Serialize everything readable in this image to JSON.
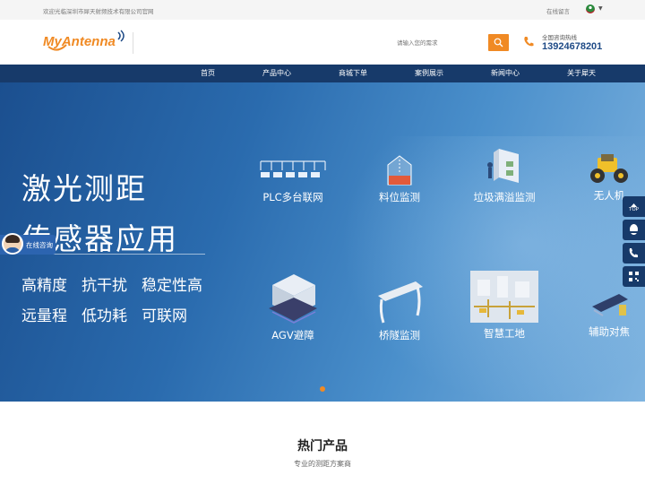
{
  "topbar": {
    "welcome": "欢迎光临深圳市犀天射频技术有限公司官网",
    "message": "在线留言",
    "lang_icon": "flag-icon"
  },
  "header": {
    "logo": "MyAntenna",
    "search_placeholder": "请输入您的需求",
    "hotline_label": "全国咨询热线",
    "hotline_number": "13924678201"
  },
  "nav": {
    "items": [
      "首页",
      "产品中心",
      "商城下单",
      "案例展示",
      "新闻中心",
      "关于犀天"
    ]
  },
  "banner": {
    "title1": "激光测距",
    "title2": "传感器应用",
    "features1": [
      "高精度",
      "抗干扰",
      "稳定性高"
    ],
    "features2": [
      "远量程",
      "低功耗",
      "可联网"
    ],
    "apps": [
      "PLC多台联网",
      "料位监测",
      "垃圾满溢监测",
      "无人机",
      "AGV避障",
      "桥隧监测",
      "智慧工地",
      "辅助对焦"
    ]
  },
  "consult": {
    "label": "在线咨询"
  },
  "side": {
    "top": "TOP"
  },
  "section": {
    "title": "热门产品",
    "subtitle": "专业的测距方案商"
  },
  "colors": {
    "nav_bg": "#173a6a",
    "accent": "#f08a24",
    "hotline": "#1e4a86"
  }
}
